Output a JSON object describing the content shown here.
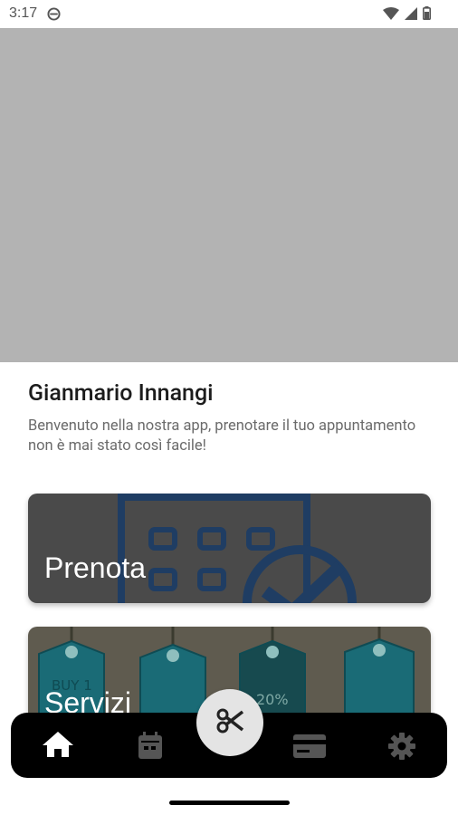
{
  "status_bar": {
    "time": "3:17"
  },
  "header": {
    "title": "Gianmario Innangi",
    "subtitle": "Benvenuto nella nostra app, prenotare il tuo appuntamento non è mai stato così facile!"
  },
  "cards": [
    {
      "label": "Prenota"
    },
    {
      "label": "Servizi",
      "tags": [
        "BUY 1",
        "20%"
      ]
    }
  ],
  "nav": {
    "items": [
      "home-icon",
      "calendar-icon",
      "scissors-icon",
      "card-icon",
      "settings-icon"
    ]
  },
  "colors": {
    "accent": "#ffffff",
    "nav_bg": "#000000",
    "hero_bg": "#b3b3b3"
  }
}
